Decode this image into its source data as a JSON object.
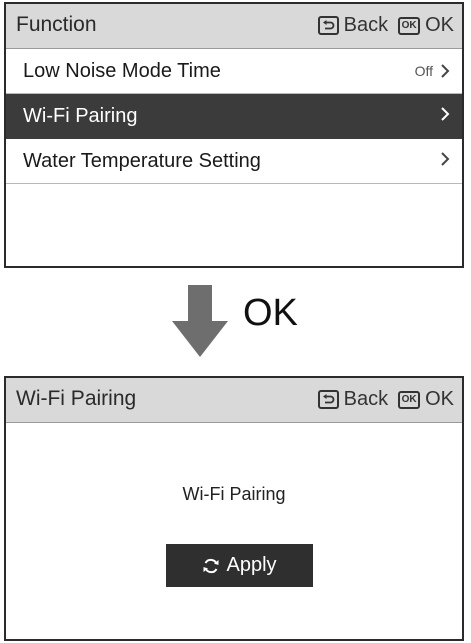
{
  "screen1": {
    "title": "Function",
    "back_label": "Back",
    "ok_icon_text": "OK",
    "ok_label": "OK",
    "items": [
      {
        "label": "Low Noise Mode Time",
        "value": "Off",
        "selected": false
      },
      {
        "label": "Wi-Fi Pairing",
        "value": "",
        "selected": true
      },
      {
        "label": "Water Temperature Setting",
        "value": "",
        "selected": false
      }
    ]
  },
  "transition": {
    "caption": "OK",
    "arrow_icon": "arrow-down-icon"
  },
  "screen2": {
    "title": "Wi-Fi Pairing",
    "back_label": "Back",
    "ok_icon_text": "OK",
    "ok_label": "OK",
    "content_label": "Wi-Fi Pairing",
    "apply_label": "Apply",
    "apply_icon": "refresh-icon"
  },
  "colors": {
    "titlebar": "#d9d9d9",
    "selected_row": "#3b3b3b",
    "button": "#2f2f2f",
    "arrow": "#6e6e6e"
  }
}
